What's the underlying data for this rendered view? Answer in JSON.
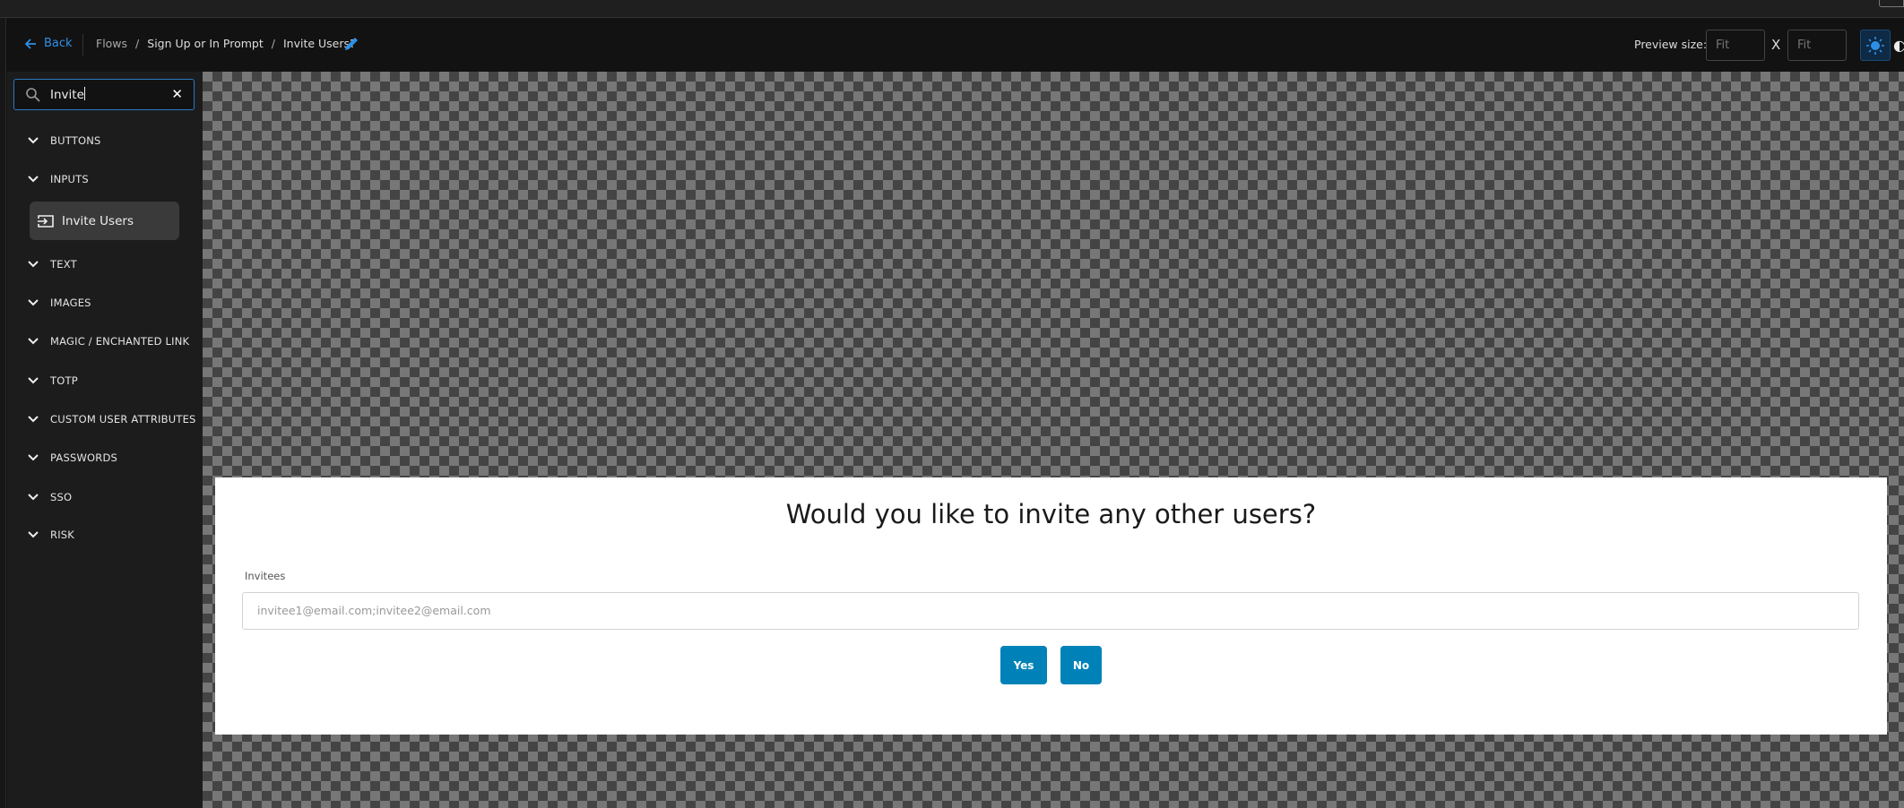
{
  "header": {
    "back_label": "Back",
    "breadcrumbs": [
      "Flows",
      "Sign Up or In Prompt",
      "Invite Users?"
    ],
    "preview_size_label": "Preview size:",
    "width_placeholder": "Fit",
    "height_placeholder": "Fit",
    "separator": "X"
  },
  "sidebar": {
    "search_value": "Invite",
    "categories": [
      "BUTTONS",
      "INPUTS",
      "TEXT",
      "IMAGES",
      "MAGIC / ENCHANTED LINK",
      "TOTP",
      "CUSTOM USER ATTRIBUTES",
      "PASSWORDS",
      "SSO",
      "RISK"
    ],
    "result_item": "Invite Users"
  },
  "preview": {
    "title": "Would you like to invite any other users?",
    "field_label": "Invitees",
    "field_placeholder": "invitee1@email.com;invitee2@email.com",
    "yes_label": "Yes",
    "no_label": "No",
    "button_color": "#0082b8"
  },
  "colors": {
    "accent": "#2f8fe6"
  }
}
